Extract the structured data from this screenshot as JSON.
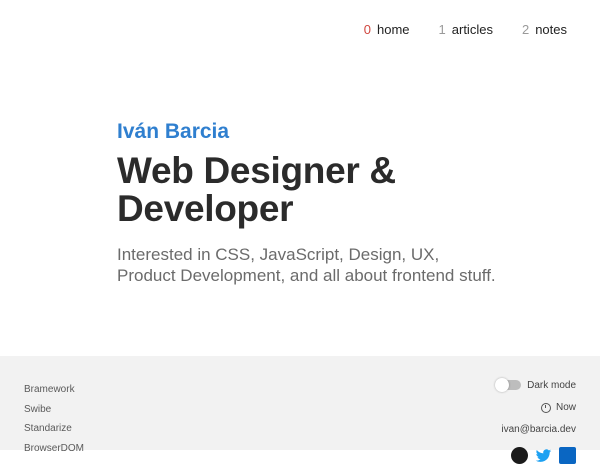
{
  "nav": {
    "items": [
      {
        "num": "0",
        "label": "home"
      },
      {
        "num": "1",
        "label": "articles"
      },
      {
        "num": "2",
        "label": "notes"
      }
    ]
  },
  "hero": {
    "name": "Iván Barcia",
    "title": "Web Designer & Developer",
    "description": "Interested in CSS, JavaScript, Design, UX, Product Development, and all about frontend stuff."
  },
  "footer": {
    "links": [
      "Bramework",
      "Swibe",
      "Standarize",
      "BrowserDOM"
    ],
    "dark_mode_label": "Dark mode",
    "now_label": "Now",
    "email": "ivan@barcia.dev",
    "social": [
      "github-icon",
      "twitter-icon",
      "linkedin-icon"
    ]
  },
  "colors": {
    "accent_blue": "#2f7fcf",
    "active_red": "#d0463e",
    "footer_bg": "#f2f2f2"
  }
}
